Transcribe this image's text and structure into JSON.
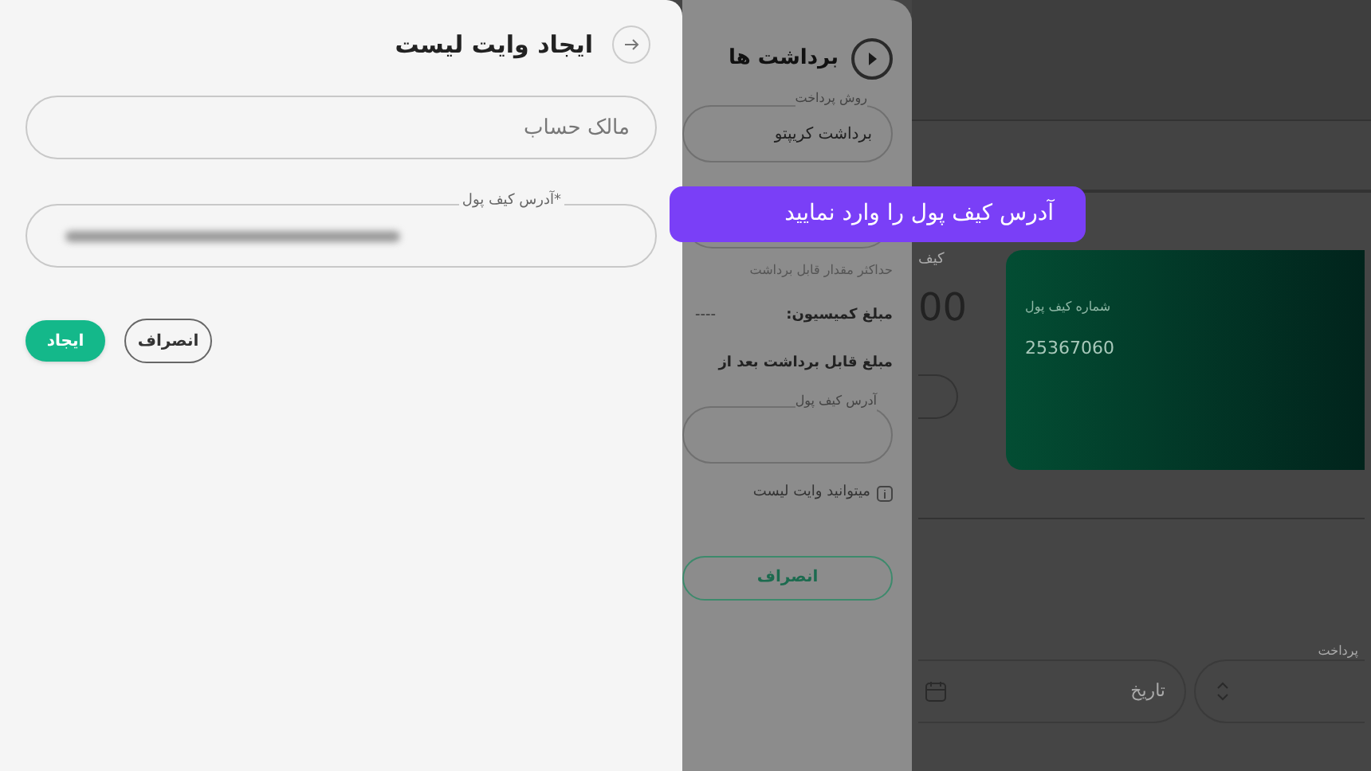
{
  "create_whitelist_panel": {
    "title": "ایجاد وایت لیست",
    "fields": [
      {
        "kind": "placeholder",
        "placeholder": "مالک حساب"
      },
      {
        "kind": "blurred",
        "label": "*آدرس کیف پول"
      }
    ],
    "buttons": [
      {
        "kind": "outline",
        "label": "انصراف"
      },
      {
        "kind": "primary",
        "label": "ایجاد"
      }
    ]
  },
  "withdrawals_panel": {
    "title": "برداشت ها",
    "method_label": "روش پرداخت",
    "method_value": "برداشت کریپتو",
    "max_label": "حداکثر مقدار قابل برداشت",
    "commission_label": "مبلغ کمیسیون:",
    "commission_value": "----",
    "net_label": "مبلغ قابل برداشت بعد از",
    "address_label": "آدرس کیف پول",
    "whitelist_note": "میتوانید وایت لیست",
    "cancel": "انصراف"
  },
  "callout": "آدرس کیف پول را وارد نمایید",
  "background": {
    "wallet_label": "کیف",
    "amount": "00",
    "card": {
      "label": "شماره کیف پول",
      "number": "25367060"
    },
    "date_placeholder": "تاریخ",
    "select_label": "پرداخت"
  }
}
